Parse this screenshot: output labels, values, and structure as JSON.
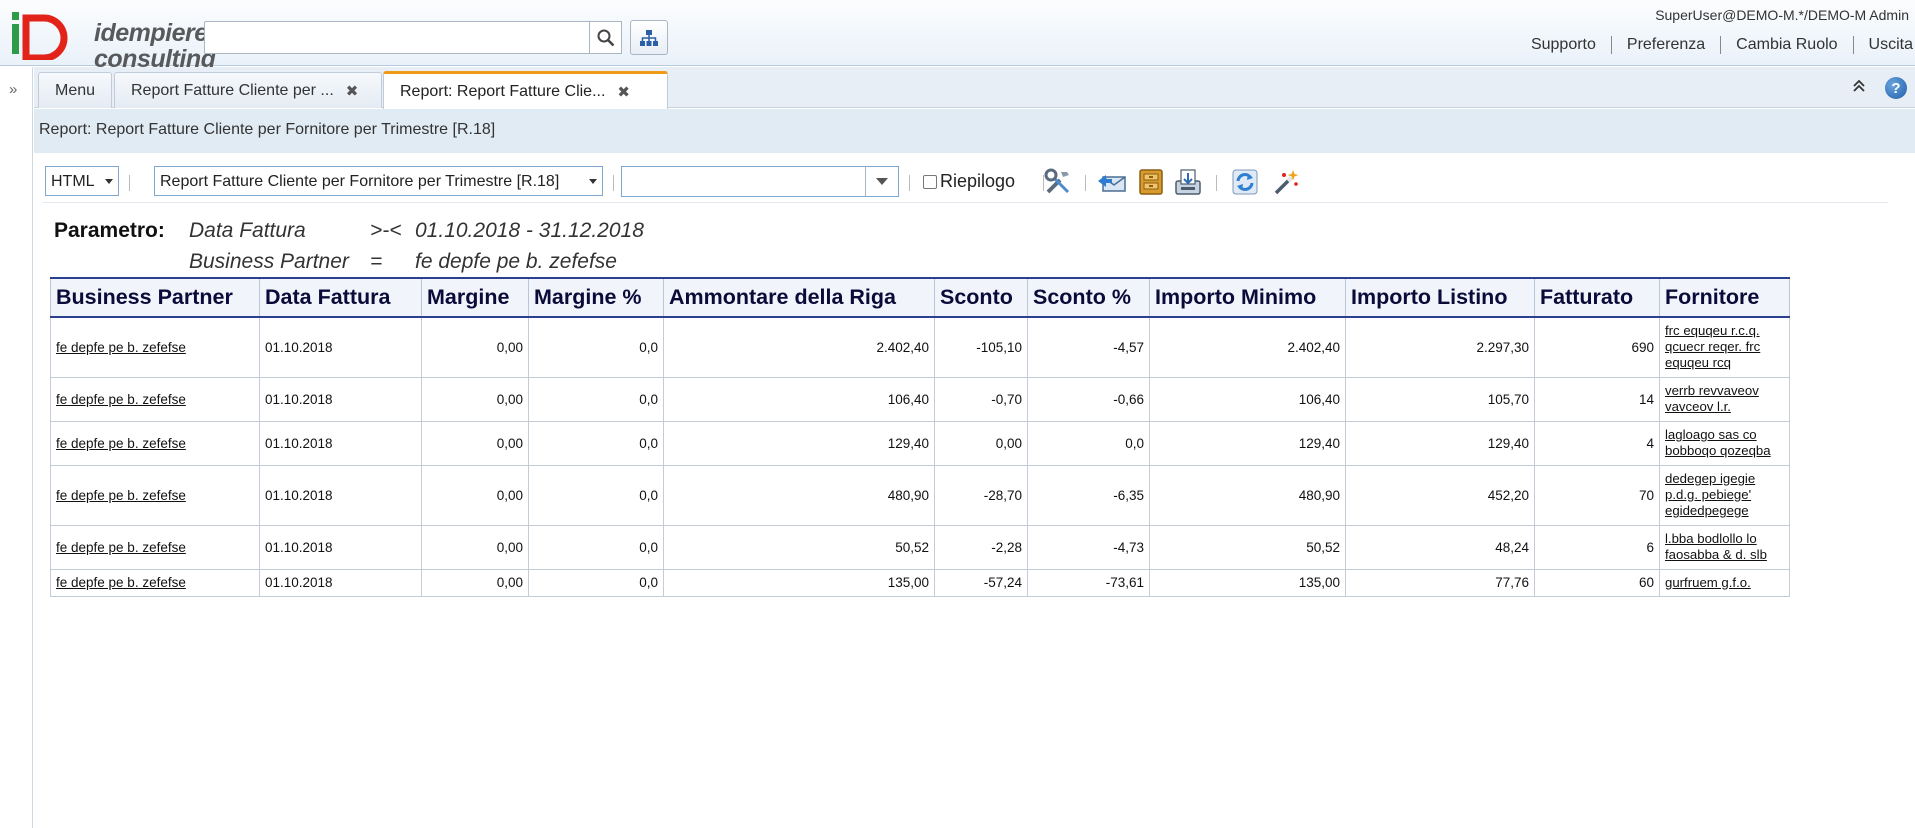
{
  "header": {
    "logo_text": "iD",
    "logo_company": [
      "idempiere",
      "consulting"
    ],
    "search_placeholder": "",
    "user": "SuperUser@DEMO-M.*/DEMO-M Admin",
    "links": [
      "Supporto",
      "Preferenza",
      "Cambia Ruolo",
      "Uscita"
    ]
  },
  "tabs": [
    {
      "label": "Menu",
      "closable": false,
      "active": false
    },
    {
      "label": "Report Fatture Cliente per ...",
      "closable": true,
      "active": false
    },
    {
      "label": "Report: Report Fatture Clie...",
      "closable": true,
      "active": true
    }
  ],
  "window_title": "Report: Report Fatture Cliente per Fornitore per Trimestre [R.18]",
  "toolbar": {
    "format_value": "HTML",
    "print_format_value": "Report Fatture Cliente per Fornitore per Trimestre [R.18]",
    "view_value": "",
    "summary_label": "Riepilogo",
    "summary_checked": false,
    "icons": [
      "customize-icon",
      "send-icon",
      "archive-icon",
      "export-icon",
      "refresh-icon",
      "wizard-icon"
    ]
  },
  "params": {
    "label": "Parametro:",
    "rows": [
      {
        "name": "Data Fattura",
        "operator": ">-<",
        "value": "01.10.2018 - 31.12.2018"
      },
      {
        "name": "Business Partner",
        "operator": "=",
        "value": "fe depfe pe b. zefefse"
      }
    ]
  },
  "report": {
    "columns": [
      "Business Partner",
      "Data Fattura",
      "Margine",
      "Margine %",
      "Ammontare della Riga",
      "Sconto",
      "Sconto %",
      "Importo Minimo",
      "Importo Listino",
      "Fatturato",
      "Fornitore"
    ],
    "rows": [
      {
        "bp": "fe depfe pe b. zefefse",
        "date": "01.10.2018",
        "margine": "0,00",
        "margine_pct": "0,0",
        "ammontare": "2.402,40",
        "sconto": "-105,10",
        "sconto_pct": "-4,57",
        "minimo": "2.402,40",
        "listino": "2.297,30",
        "fatturato": "690",
        "fornitore": [
          "frc equqeu r.c.q.",
          "qcuecr reqer. frc",
          "equqeu rcq"
        ]
      },
      {
        "bp": "fe depfe pe b. zefefse",
        "date": "01.10.2018",
        "margine": "0,00",
        "margine_pct": "0,0",
        "ammontare": "106,40",
        "sconto": "-0,70",
        "sconto_pct": "-0,66",
        "minimo": "106,40",
        "listino": "105,70",
        "fatturato": "14",
        "fornitore": [
          "verrb revvaveov",
          "vavceov l.r."
        ]
      },
      {
        "bp": "fe depfe pe b. zefefse",
        "date": "01.10.2018",
        "margine": "0,00",
        "margine_pct": "0,0",
        "ammontare": "129,40",
        "sconto": "0,00",
        "sconto_pct": "0,0",
        "minimo": "129,40",
        "listino": "129,40",
        "fatturato": "4",
        "fornitore": [
          "lagloago sas co",
          "bobboqo qozeqba"
        ]
      },
      {
        "bp": "fe depfe pe b. zefefse",
        "date": "01.10.2018",
        "margine": "0,00",
        "margine_pct": "0,0",
        "ammontare": "480,90",
        "sconto": "-28,70",
        "sconto_pct": "-6,35",
        "minimo": "480,90",
        "listino": "452,20",
        "fatturato": "70",
        "fornitore": [
          "dedegep igegie",
          "p.d.g. pebiege'",
          "egidedpegege"
        ]
      },
      {
        "bp": "fe depfe pe b. zefefse",
        "date": "01.10.2018",
        "margine": "0,00",
        "margine_pct": "0,0",
        "ammontare": "50,52",
        "sconto": "-2,28",
        "sconto_pct": "-4,73",
        "minimo": "50,52",
        "listino": "48,24",
        "fatturato": "6",
        "fornitore": [
          "l.bba bodlollo lo",
          "faosabba & d. slb"
        ]
      },
      {
        "bp": "fe depfe pe b. zefefse",
        "date": "01.10.2018",
        "margine": "0,00",
        "margine_pct": "0,0",
        "ammontare": "135,00",
        "sconto": "-57,24",
        "sconto_pct": "-73,61",
        "minimo": "135,00",
        "listino": "77,76",
        "fatturato": "60",
        "fornitore": [
          "gurfruem g.f.o."
        ]
      }
    ]
  },
  "colors": {
    "accent_tab": "#ef9b17",
    "header_border": "#2a3f8f",
    "logo_red": "#e2231a",
    "logo_green": "#2e9b48",
    "title_bg": "#e1ebf4"
  }
}
